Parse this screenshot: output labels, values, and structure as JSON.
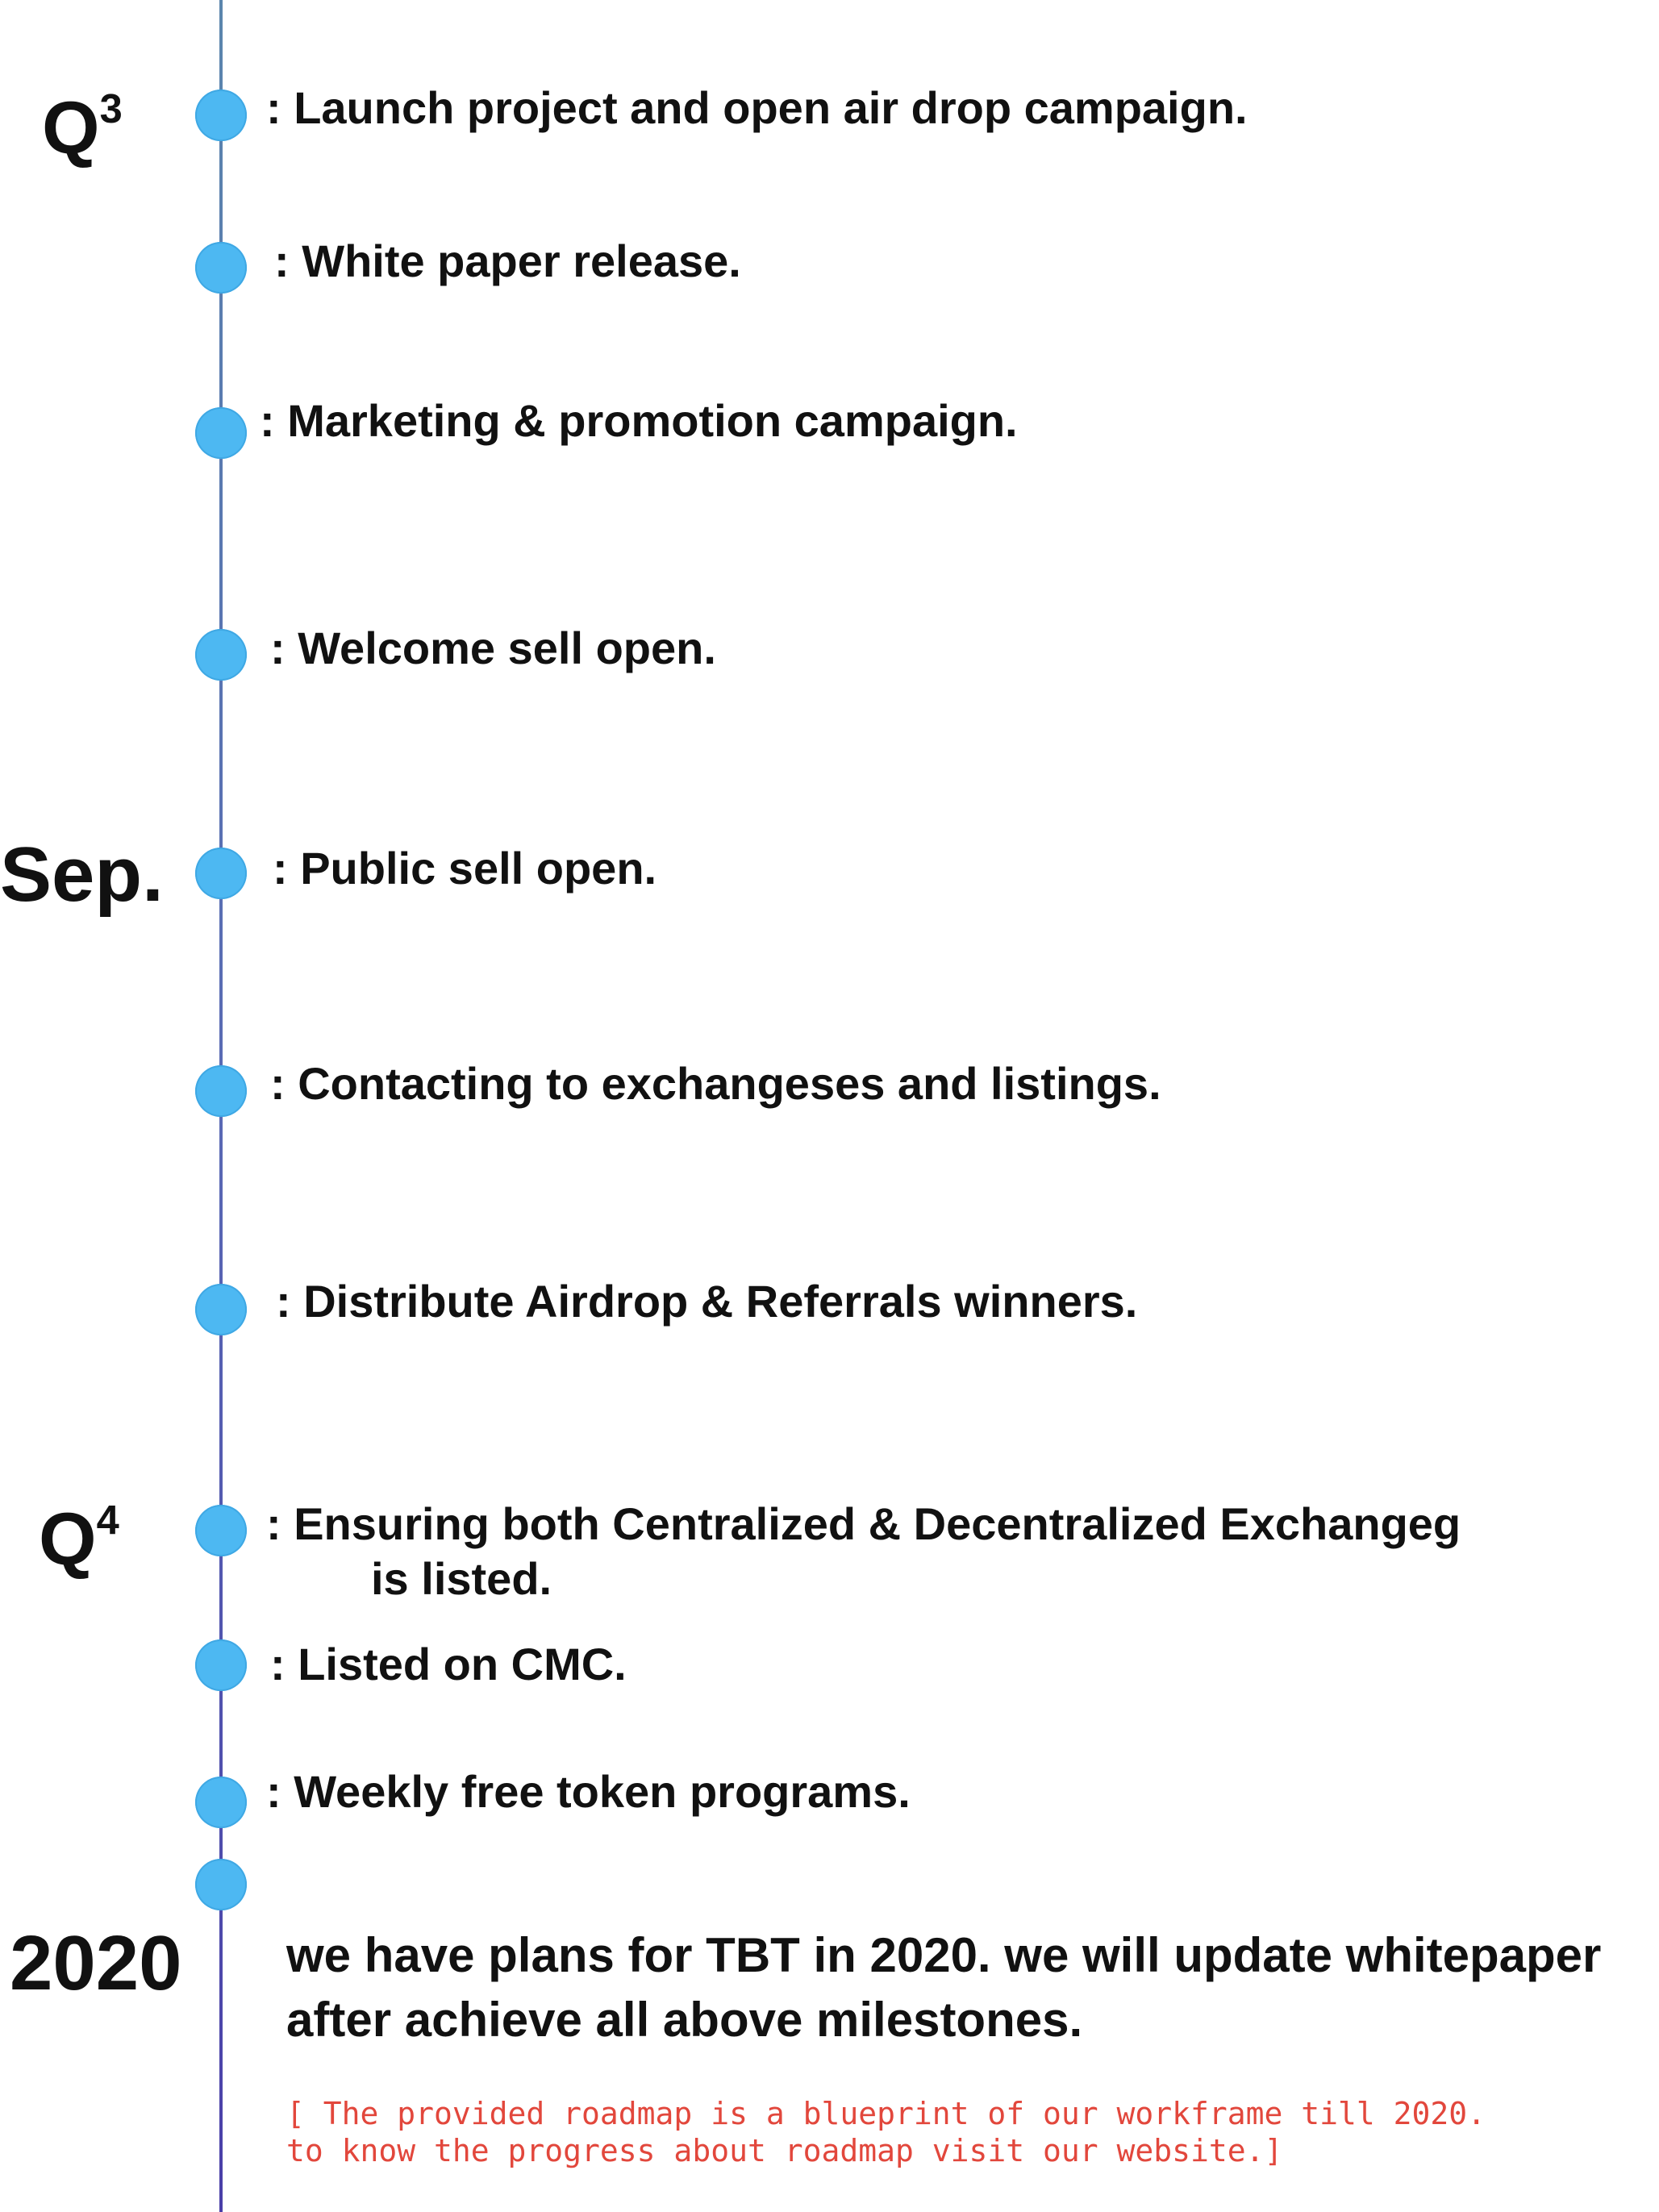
{
  "periods": {
    "q3": {
      "label": "Q",
      "sup": "3"
    },
    "sep": {
      "label": "Sep."
    },
    "q4": {
      "label": "Q",
      "sup": "4"
    },
    "y2020": {
      "label": "2020"
    }
  },
  "milestones": [
    {
      "text": ": Launch project and open air drop campaign."
    },
    {
      "text": ": White paper release."
    },
    {
      "text": ": Marketing & promotion campaign."
    },
    {
      "text": ": Welcome sell open."
    },
    {
      "text": ": Public sell open."
    },
    {
      "text": ": Contacting to exchangeses and listings."
    },
    {
      "text": ": Distribute Airdrop & Referrals winners."
    },
    {
      "text": ": Ensuring both Centralized & Decentralized Exchangeg",
      "text2": "is listed."
    },
    {
      "text": ": Listed on CMC."
    },
    {
      "text": ": Weekly free token programs."
    }
  ],
  "plan_2020": {
    "line1": "we have plans for TBT in 2020. we will update whitepaper",
    "line2": "after achieve all above milestones."
  },
  "note": {
    "line1": "[ The provided roadmap is a blueprint of our workframe till 2020.",
    "line2": "to know the progress about roadmap visit our website.]"
  },
  "colors": {
    "dot": "#4db8f2",
    "note": "#e2473c",
    "line_top": "#5b86ad",
    "line_bottom": "#4a3fa8"
  }
}
